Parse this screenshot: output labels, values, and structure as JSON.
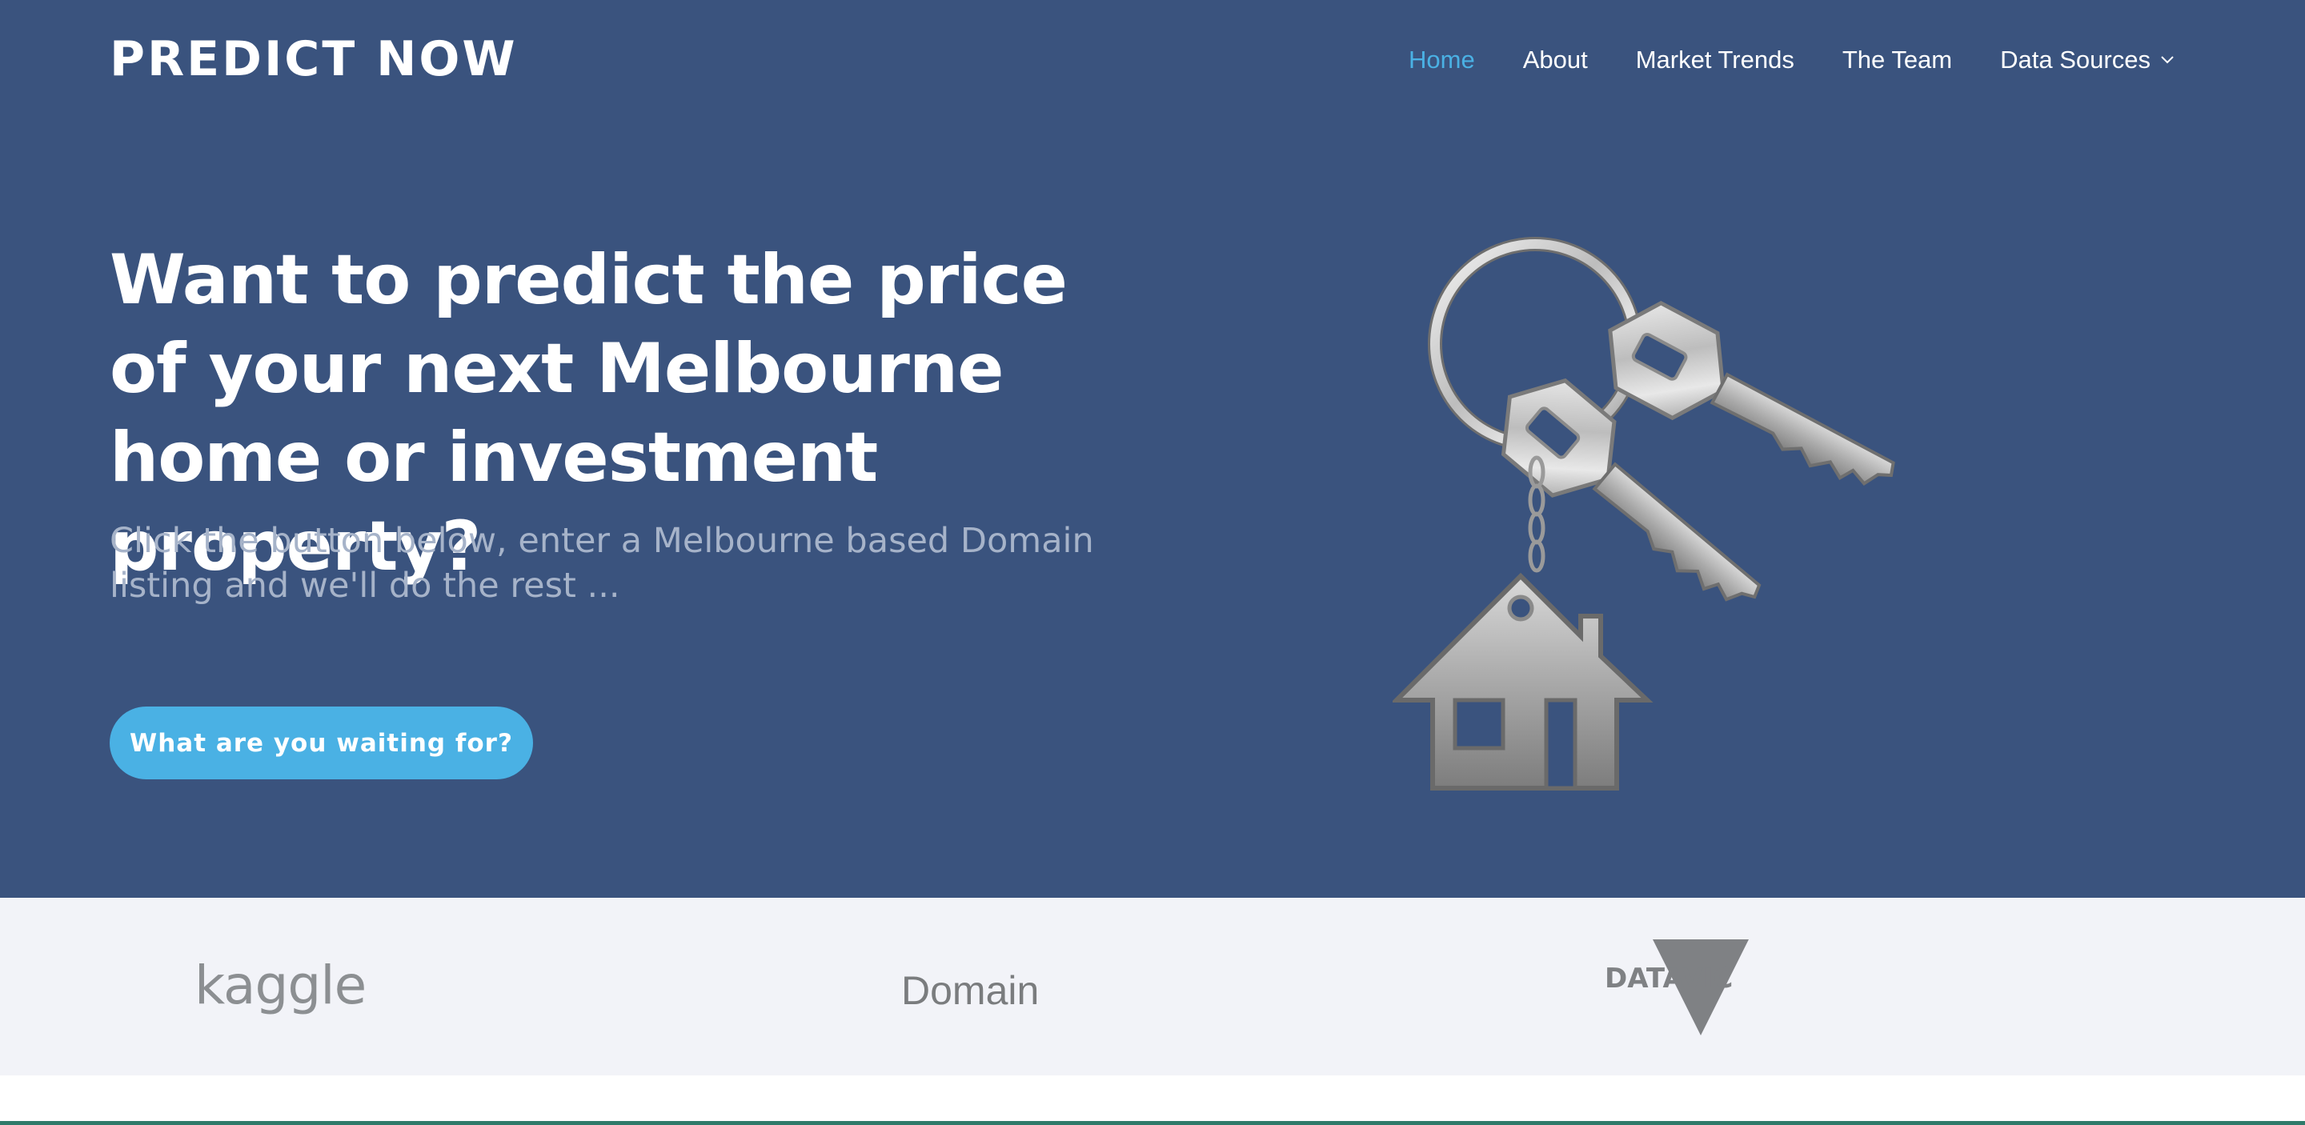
{
  "brand": {
    "name": "PREDICT NOW"
  },
  "nav": {
    "items": [
      {
        "label": "Home",
        "active": true
      },
      {
        "label": "About"
      },
      {
        "label": "Market Trends"
      },
      {
        "label": "The Team"
      },
      {
        "label": "Data Sources",
        "has_dropdown": true
      }
    ]
  },
  "hero": {
    "headline": "Want to predict the price of your next Melbourne home or investment property?",
    "subheadline": "Click the button below, enter a Melbourne based Domain listing and we'll do the rest ...",
    "cta_label": "What are you waiting for?",
    "illustration": "house-keys-keychain"
  },
  "logos": {
    "kaggle": "kaggle",
    "domain": "Domain",
    "datavic": "DATAVIC"
  },
  "colors": {
    "hero_bg": "#3a537e",
    "accent": "#4ab1e4",
    "subtext": "#a6b3c9",
    "logo_strip_bg": "#f2f3f8"
  }
}
